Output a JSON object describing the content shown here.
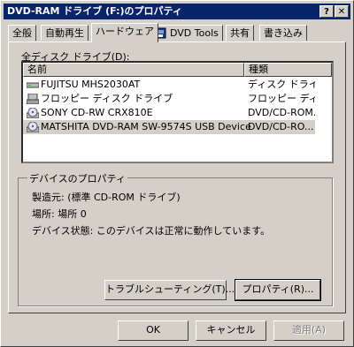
{
  "window": {
    "title": "DVD-RAM ドライブ (F:)のプロパティ",
    "help_label": "?",
    "close_label": "✕"
  },
  "tabs": [
    {
      "label": "全般"
    },
    {
      "label": "自動再生"
    },
    {
      "label": "ハードウェア"
    },
    {
      "label": "DVD Tools"
    },
    {
      "label": "共有"
    },
    {
      "label": "書き込み"
    }
  ],
  "drives_label": "全ディスク ドライブ(D):",
  "list": {
    "headers": [
      "名前",
      "種類"
    ],
    "rows": [
      {
        "name": "FUJITSU MHS2030AT",
        "type": "ディスク ドライブ",
        "icon": "hard-disk-icon"
      },
      {
        "name": "フロッピー ディスク ドライブ",
        "type": "フロッピー ディ...",
        "icon": "floppy-drive-icon"
      },
      {
        "name": "SONY CD-RW  CRX810E",
        "type": "DVD/CD-ROM...",
        "icon": "cd-drive-icon"
      },
      {
        "name": "MATSHITA DVD-RAM SW-9574S USB Device",
        "type": "DVD/CD-RO...",
        "icon": "cd-drive-icon"
      }
    ]
  },
  "properties": {
    "title": "デバイスのプロパティ",
    "manufacturer": "製造元: (標準 CD-ROM ドライブ)",
    "location": "場所: 場所 0",
    "status": "デバイス状態: このデバイスは正常に動作しています。"
  },
  "buttons": {
    "troubleshoot": "トラブルシューティング(T)...",
    "properties": "プロパティ(R)...",
    "ok": "OK",
    "cancel": "キャンセル",
    "apply": "適用(A)"
  },
  "colors": {
    "titlebar": "#0a246a",
    "face": "#d4d0c8"
  }
}
